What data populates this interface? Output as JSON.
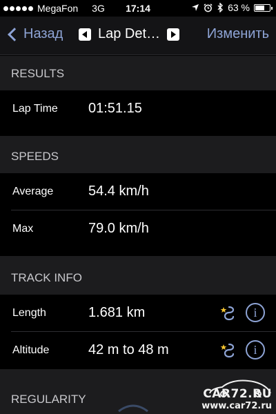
{
  "status_bar": {
    "carrier": "MegaFon",
    "network": "3G",
    "time": "17:14",
    "battery_text": "63 %",
    "battery_level": 0.63
  },
  "nav": {
    "back_label": "Назад",
    "title": "Lap Det…",
    "edit_label": "Изменить",
    "accent_color": "#8ea4d6"
  },
  "sections": {
    "results": {
      "header": "RESULTS",
      "rows": [
        {
          "label": "Lap Time",
          "value": "01:51.15"
        }
      ]
    },
    "speeds": {
      "header": "SPEEDS",
      "rows": [
        {
          "label": "Average",
          "value": "54.4 km/h"
        },
        {
          "label": "Max",
          "value": "79.0 km/h"
        }
      ]
    },
    "track_info": {
      "header": "TRACK INFO",
      "rows": [
        {
          "label": "Length",
          "value": "1.681 km",
          "icons": [
            "route-star-icon",
            "info-icon"
          ]
        },
        {
          "label": "Altitude",
          "value": "42 m to 48 m",
          "icons": [
            "route-star-icon",
            "info-icon"
          ]
        }
      ]
    },
    "regularity": {
      "header": "REGULARITY"
    }
  },
  "watermark": {
    "logo": "CAR72.RU",
    "url": "www.car72.ru"
  }
}
